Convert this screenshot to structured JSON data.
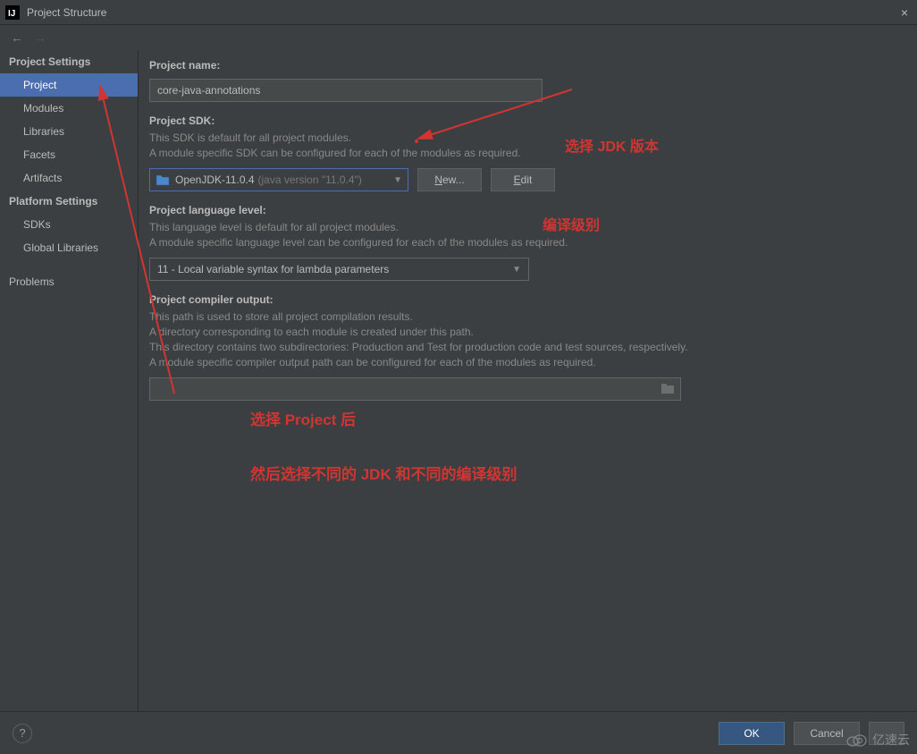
{
  "window": {
    "title": "Project Structure",
    "close_label": "×"
  },
  "sidebar": {
    "project_settings_header": "Project Settings",
    "project_items": [
      "Project",
      "Modules",
      "Libraries",
      "Facets",
      "Artifacts"
    ],
    "platform_settings_header": "Platform Settings",
    "platform_items": [
      "SDKs",
      "Global Libraries"
    ],
    "problems_label": "Problems",
    "selected_index": 0
  },
  "content": {
    "project_name_label": "Project name:",
    "project_name_value": "core-java-annotations",
    "project_sdk_label": "Project SDK:",
    "project_sdk_desc1": "This SDK is default for all project modules.",
    "project_sdk_desc2": "A module specific SDK can be configured for each of the modules as required.",
    "sdk_selected_name": "OpenJDK-11.0.4",
    "sdk_selected_version": "(java version \"11.0.4\")",
    "new_button": "New...",
    "edit_button": "Edit",
    "lang_level_label": "Project language level:",
    "lang_level_desc1": "This language level is default for all project modules.",
    "lang_level_desc2": "A module specific language level can be configured for each of the modules as required.",
    "lang_level_value": "11 - Local variable syntax for lambda parameters",
    "compiler_output_label": "Project compiler output:",
    "compiler_output_desc1": "This path is used to store all project compilation results.",
    "compiler_output_desc2": "A directory corresponding to each module is created under this path.",
    "compiler_output_desc3": "This directory contains two subdirectories: Production and Test for production code and test sources, respectively.",
    "compiler_output_desc4": "A module specific compiler output path can be configured for each of the modules as required."
  },
  "buttons": {
    "ok": "OK",
    "cancel": "Cancel",
    "help": "?"
  },
  "annotations": {
    "sdk_note": "选择 JDK 版本",
    "lang_note": "编译级别",
    "bottom_note1": "选择 Project 后",
    "bottom_note2": "然后选择不同的 JDK 和不同的编译级别"
  },
  "watermark": "亿速云"
}
